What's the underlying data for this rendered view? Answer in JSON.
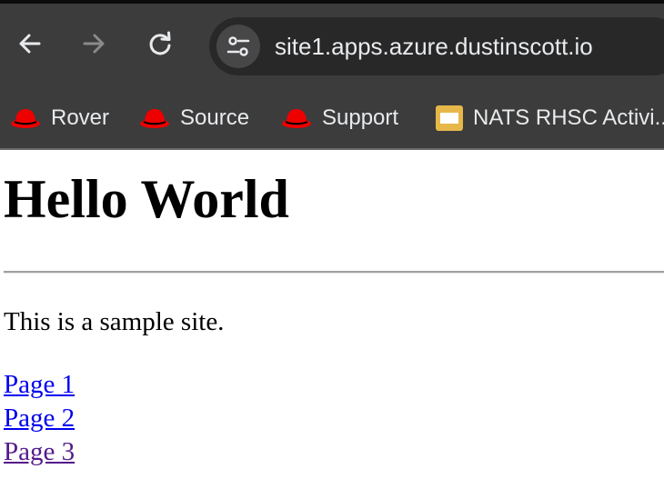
{
  "browser": {
    "url": "site1.apps.azure.dustinscott.io",
    "bookmarks": [
      {
        "label": "Rover",
        "icon": "redhat-fedora-icon"
      },
      {
        "label": "Source",
        "icon": "redhat-fedora-icon"
      },
      {
        "label": "Support",
        "icon": "redhat-fedora-icon"
      },
      {
        "label": "NATS RHSC Activi...",
        "icon": "folder-icon"
      }
    ],
    "colors": {
      "toolbar": "#3c3c3c",
      "omnibox": "#282828",
      "text": "#e8eaed",
      "redhat": "#ee0000",
      "folder": "#e6b84a"
    }
  },
  "page": {
    "heading": "Hello World",
    "paragraph": "This is a sample site.",
    "links": [
      {
        "label": "Page 1",
        "visited": false
      },
      {
        "label": "Page 2",
        "visited": false
      },
      {
        "label": "Page 3",
        "visited": true
      }
    ],
    "colors": {
      "link": "#0000ee",
      "visited_link": "#551a8b"
    }
  }
}
